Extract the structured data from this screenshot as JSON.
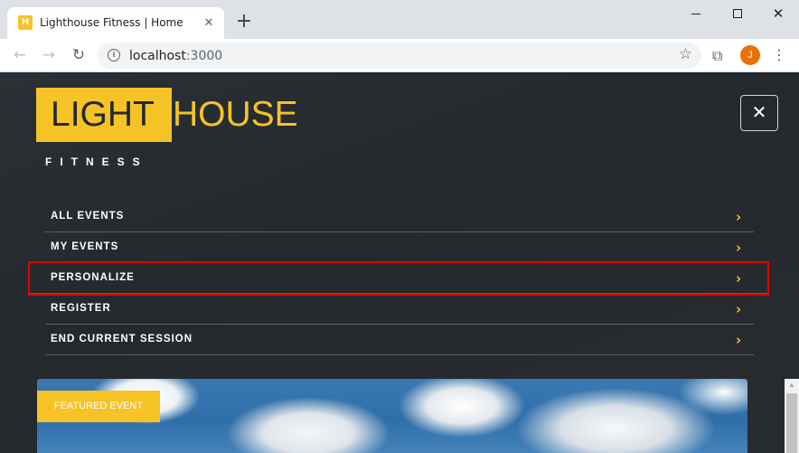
{
  "browser": {
    "tab_title": "Lighthouse Fitness | Home",
    "tab_favicon_letter": "H",
    "url_host": "localhost",
    "url_port": ":3000",
    "profile_initial": "J"
  },
  "brand": {
    "logo_light": "LIGHT",
    "logo_house": "HOUSE",
    "logo_sub": "FITNESS",
    "accent_color": "#f6c327"
  },
  "menu": {
    "items": [
      {
        "label": "ALL EVENTS"
      },
      {
        "label": "MY EVENTS"
      },
      {
        "label": "PERSONALIZE"
      },
      {
        "label": "REGISTER"
      },
      {
        "label": "END CURRENT SESSION"
      }
    ],
    "highlight_color": "#e00000"
  },
  "hero": {
    "badge": "FEATURED EVENT"
  },
  "icons": {
    "close": "✕",
    "chevron": "›",
    "back": "←",
    "forward": "→",
    "reload": "↻",
    "star": "☆",
    "extensions": "⧉",
    "menu": "⋮",
    "new_tab": "+"
  }
}
